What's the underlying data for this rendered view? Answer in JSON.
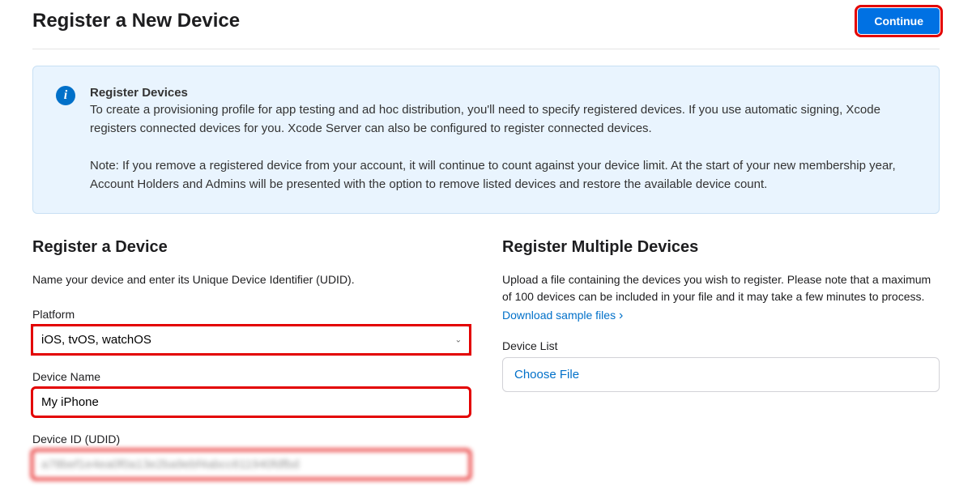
{
  "header": {
    "title": "Register a New Device",
    "continue_label": "Continue"
  },
  "info": {
    "title": "Register Devices",
    "body": "To create a provisioning profile for app testing and ad hoc distribution, you'll need to specify registered devices. If you use automatic signing, Xcode registers connected devices for you. Xcode Server can also be configured to register connected devices.",
    "note": "Note: If you remove a registered device from your account, it will continue to count against your device limit. At the start of your new membership year, Account Holders and Admins will be presented with the option to remove listed devices and restore the available device count."
  },
  "single": {
    "title": "Register a Device",
    "desc": "Name your device and enter its Unique Device Identifier (UDID).",
    "platform_label": "Platform",
    "platform_value": "iOS, tvOS, watchOS",
    "device_name_label": "Device Name",
    "device_name_value": "My iPhone",
    "device_id_label": "Device ID (UDID)",
    "device_id_value": "a78bef1e4ea0f0a13e2ba9ebf4abcc611940fdfbd"
  },
  "multiple": {
    "title": "Register Multiple Devices",
    "desc": "Upload a file containing the devices you wish to register. Please note that a maximum of 100 devices can be included in your file and it may take a few minutes to process.",
    "download_link": "Download sample files",
    "device_list_label": "Device List",
    "choose_file_label": "Choose File"
  }
}
